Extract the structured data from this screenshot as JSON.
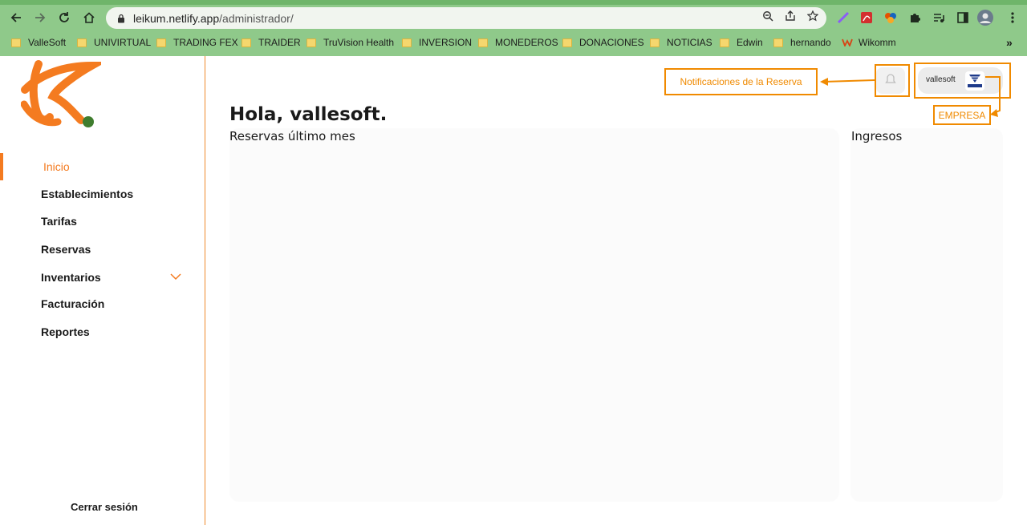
{
  "browser": {
    "url_host": "leikum.netlify.app",
    "url_path": "/administrador/",
    "bookmarks": [
      {
        "label": "ValleSoft"
      },
      {
        "label": "UNIVIRTUAL"
      },
      {
        "label": "TRADING FEX"
      },
      {
        "label": "TRAIDER"
      },
      {
        "label": "TruVision Health"
      },
      {
        "label": "INVERSION"
      },
      {
        "label": "MONEDEROS"
      },
      {
        "label": "DONACIONES"
      },
      {
        "label": "NOTICIAS"
      },
      {
        "label": "Edwin"
      },
      {
        "label": "hernando"
      },
      {
        "label": "Wikomm"
      }
    ],
    "more": "»"
  },
  "sidebar": {
    "items": [
      {
        "label": "Inicio"
      },
      {
        "label": "Establecimientos"
      },
      {
        "label": "Tarifas"
      },
      {
        "label": "Reservas"
      },
      {
        "label": "Inventarios"
      },
      {
        "label": "Facturación"
      },
      {
        "label": "Reportes"
      }
    ],
    "logout": "Cerrar sesión"
  },
  "main": {
    "greeting": "Hola, vallesoft.",
    "card_reservas_title": "Reservas último mes",
    "card_ingresos_title": "Ingresos",
    "user_name": "vallesoft"
  },
  "annotations": {
    "notifications": "Notificaciones de la Reserva",
    "company": "EMPRESA"
  },
  "colors": {
    "accent": "#f47b20",
    "chrome": "#8fc98a",
    "annotation": "#f08a00"
  }
}
